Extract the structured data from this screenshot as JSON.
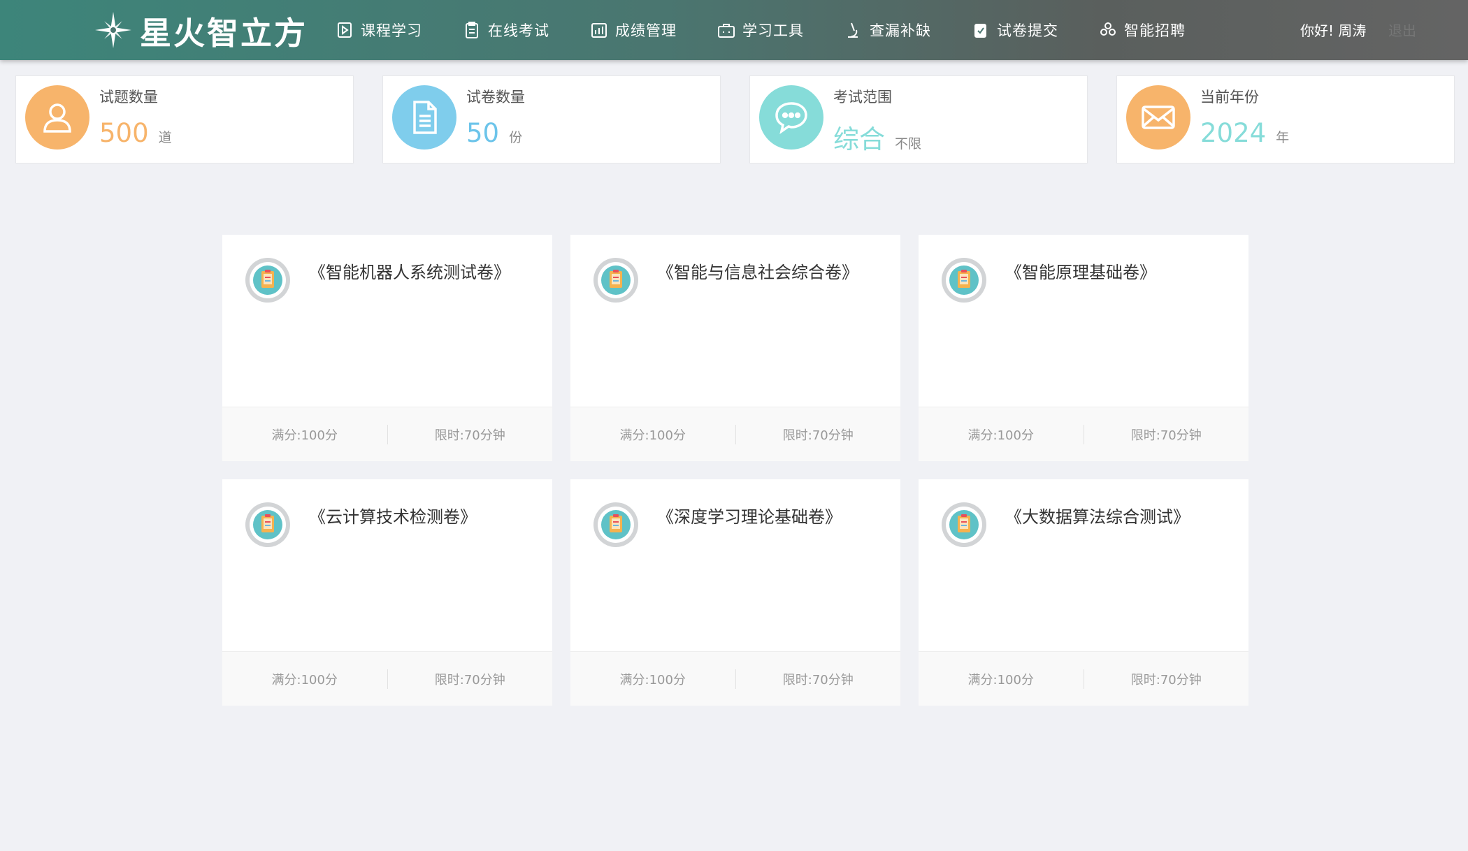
{
  "header": {
    "brand_name": "星火智立方",
    "nav": [
      {
        "label": "课程学习",
        "icon": "play-doc-icon"
      },
      {
        "label": "在线考试",
        "icon": "clipboard-icon"
      },
      {
        "label": "成绩管理",
        "icon": "chart-icon"
      },
      {
        "label": "学习工具",
        "icon": "toolbox-icon"
      },
      {
        "label": "查漏补缺",
        "icon": "microscope-icon"
      },
      {
        "label": "试卷提交",
        "icon": "submit-doc-icon"
      },
      {
        "label": "智能招聘",
        "icon": "people-icon"
      }
    ],
    "greeting": "你好!  周涛",
    "logout_label": "退出"
  },
  "stats": [
    {
      "label": "试题数量",
      "value": "500",
      "unit": "道",
      "icon": "user-icon",
      "icon_bg": "#f7b46b",
      "value_color": "#f7b46b"
    },
    {
      "label": "试卷数量",
      "value": "50",
      "unit": "份",
      "icon": "document-icon",
      "icon_bg": "#7fcdec",
      "value_color": "#6cc4ea"
    },
    {
      "label": "考试范围",
      "value": "综合",
      "unit": "不限",
      "icon": "chat-bubble-icon",
      "icon_bg": "#86dcd9",
      "value_color": "#86dcd9"
    },
    {
      "label": "当前年份",
      "value": "2024",
      "unit": "年",
      "icon": "mail-icon",
      "icon_bg": "#f7b46b",
      "value_color": "#86dcd9"
    }
  ],
  "exams": [
    {
      "title": "《智能机器人系统测试卷》",
      "full_score": "满分:100分",
      "time_limit": "限时:70分钟"
    },
    {
      "title": "《智能与信息社会综合卷》",
      "full_score": "满分:100分",
      "time_limit": "限时:70分钟"
    },
    {
      "title": "《智能原理基础卷》",
      "full_score": "满分:100分",
      "time_limit": "限时:70分钟"
    },
    {
      "title": "《云计算技术检测卷》",
      "full_score": "满分:100分",
      "time_limit": "限时:70分钟"
    },
    {
      "title": "《深度学习理论基础卷》",
      "full_score": "满分:100分",
      "time_limit": "限时:70分钟"
    },
    {
      "title": "《大数据算法综合测试》",
      "full_score": "满分:100分",
      "time_limit": "限时:70分钟"
    }
  ]
}
